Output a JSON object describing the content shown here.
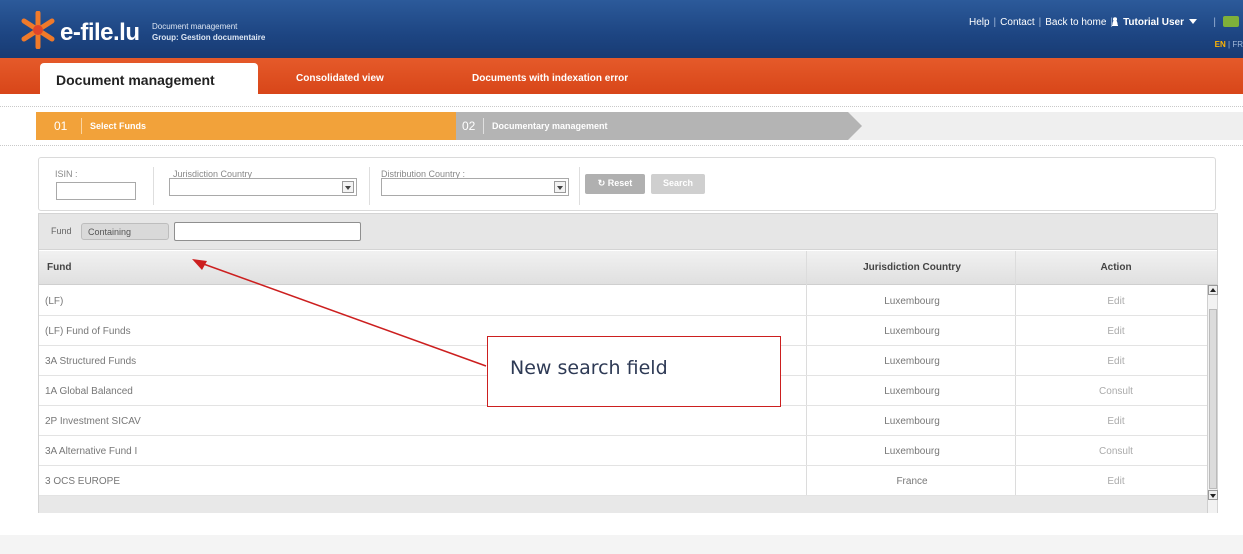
{
  "header": {
    "logo_text": "e-file.lu",
    "subtitle_line1": "Document management",
    "subtitle_line2": "Group: Gestion documentaire",
    "links": [
      "Help",
      "Contact",
      "Back to home"
    ],
    "user": "Tutorial User",
    "lang_en": "EN",
    "lang_fr": "FR"
  },
  "nav": {
    "active_tab": "Document management",
    "tabs": [
      "Consolidated view",
      "Documents with indexation error"
    ]
  },
  "steps": [
    {
      "num": "01",
      "label": "Select Funds"
    },
    {
      "num": "02",
      "label": "Documentary management"
    }
  ],
  "filters": {
    "isin_label": "ISIN :",
    "jurisdiction_label": "Jurisdiction Country",
    "distribution_label": "Distribution Country :",
    "reset_label": "Reset",
    "search_label": "Search"
  },
  "grid": {
    "fund_filter_label": "Fund",
    "fund_filter_mode": "Containing",
    "columns": [
      "Fund",
      "Jurisdiction Country",
      "Action"
    ],
    "rows": [
      {
        "fund": "(LF)",
        "jurisdiction": "Luxembourg",
        "action": "Edit"
      },
      {
        "fund": "(LF) Fund of Funds",
        "jurisdiction": "Luxembourg",
        "action": "Edit"
      },
      {
        "fund": "3A Structured Funds",
        "jurisdiction": "Luxembourg",
        "action": "Edit"
      },
      {
        "fund": "1A Global Balanced",
        "jurisdiction": "Luxembourg",
        "action": "Consult"
      },
      {
        "fund": "2P Investment SICAV",
        "jurisdiction": "Luxembourg",
        "action": "Edit"
      },
      {
        "fund": "3A Alternative Fund I",
        "jurisdiction": "Luxembourg",
        "action": "Consult"
      },
      {
        "fund": "3 OCS EUROPE",
        "jurisdiction": "France",
        "action": "Edit"
      }
    ]
  },
  "annotation": {
    "text": "New search field",
    "color": "#cc1f1f"
  },
  "colors": {
    "header_blue": "#1d4582",
    "nav_orange": "#d84619",
    "step_active": "#f2a23a",
    "step_inactive": "#b4b4b4"
  }
}
